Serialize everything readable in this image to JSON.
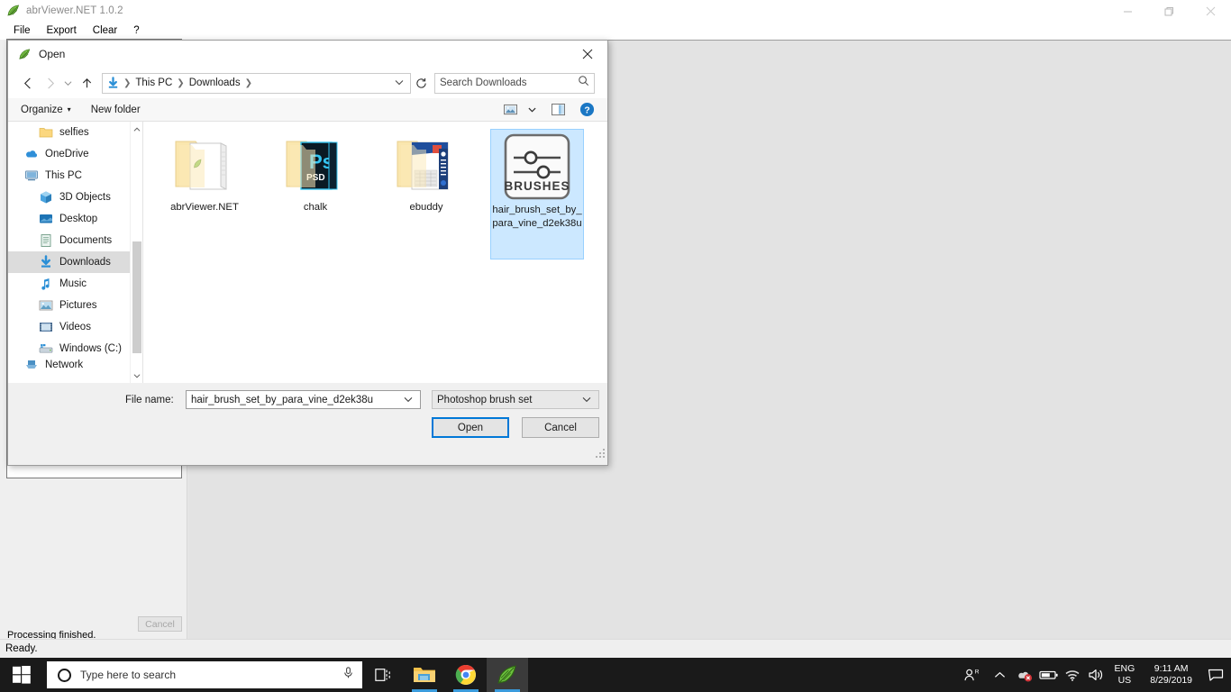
{
  "app": {
    "title": "abrViewer.NET 1.0.2",
    "icon": "leaf-brush-icon",
    "menu": [
      "File",
      "Export",
      "Clear",
      "?"
    ],
    "window_controls": {
      "minimize": "minimize-icon",
      "maximize": "restore-icon",
      "close": "close-icon"
    },
    "left_panel": {
      "cancel_label": "Cancel",
      "processing_label": "Processing finished."
    },
    "status_text": "Ready."
  },
  "dialog": {
    "title": "Open",
    "icon": "leaf-brush-icon",
    "close_label": "✕",
    "nav": {
      "back": "←",
      "forward": "→",
      "recent": "⌄",
      "up": "↑",
      "breadcrumbs": [
        "This PC",
        "Downloads"
      ],
      "address_icon": "downloads-arrow-icon",
      "dropdown_caret": "⌄",
      "refresh": "↻"
    },
    "search": {
      "placeholder": "Search Downloads",
      "icon": "search-icon"
    },
    "commandbar": {
      "organize": "Organize",
      "organize_caret": "▾",
      "new_folder": "New folder",
      "view_icon": "view-options-icon",
      "view_caret": "▾",
      "pane_icon": "preview-pane-icon",
      "help_icon": "help-icon",
      "help_glyph": "?"
    },
    "nav_pane": {
      "items": [
        {
          "label": "selfies",
          "icon": "folder-icon",
          "indent": 2,
          "selected": false
        },
        {
          "label": "OneDrive",
          "icon": "onedrive-cloud-icon",
          "indent": 1,
          "selected": false
        },
        {
          "label": "This PC",
          "icon": "this-pc-icon",
          "indent": 1,
          "selected": false
        },
        {
          "label": "3D Objects",
          "icon": "3d-objects-icon",
          "indent": 2,
          "selected": false
        },
        {
          "label": "Desktop",
          "icon": "desktop-icon",
          "indent": 2,
          "selected": false
        },
        {
          "label": "Documents",
          "icon": "documents-icon",
          "indent": 2,
          "selected": false
        },
        {
          "label": "Downloads",
          "icon": "downloads-arrow-icon",
          "indent": 2,
          "selected": true
        },
        {
          "label": "Music",
          "icon": "music-note-icon",
          "indent": 2,
          "selected": false
        },
        {
          "label": "Pictures",
          "icon": "pictures-icon",
          "indent": 2,
          "selected": false
        },
        {
          "label": "Videos",
          "icon": "videos-icon",
          "indent": 2,
          "selected": false
        },
        {
          "label": "Windows (C:)",
          "icon": "drive-icon",
          "indent": 2,
          "selected": false
        },
        {
          "label": "Network",
          "icon": "network-icon",
          "indent": 1,
          "selected": false
        }
      ],
      "scroll_up": "⌃",
      "scroll_down": "⌄"
    },
    "files": [
      {
        "name": "abrViewer.NET",
        "thumb": "folder-with-leaf-icon",
        "selected": false
      },
      {
        "name": "chalk",
        "thumb": "folder-with-psd-icon",
        "selected": false
      },
      {
        "name": "ebuddy",
        "thumb": "folder-with-document-icon",
        "selected": false
      },
      {
        "name": "hair_brush_set_by_para_vine_d2ek38u",
        "thumb": "brushes-slider-icon",
        "thumb_text": "BRUSHES",
        "selected": true
      }
    ],
    "footer": {
      "filename_label": "File name:",
      "filename_value": "hair_brush_set_by_para_vine_d2ek38u",
      "filetype_value": "Photoshop brush set",
      "combo_caret": "⌄",
      "open_label": "Open",
      "cancel_label": "Cancel"
    }
  },
  "taskbar": {
    "start_icon": "windows-logo-icon",
    "search_placeholder": "Type here to search",
    "search_icon": "search-circle-icon",
    "mic_icon": "microphone-icon",
    "buttons": [
      {
        "name": "task-view",
        "icon": "task-view-icon",
        "active": false,
        "underline": false
      },
      {
        "name": "file-explorer",
        "icon": "file-explorer-icon",
        "active": false,
        "underline": true
      },
      {
        "name": "google-chrome",
        "icon": "chrome-icon",
        "active": false,
        "underline": true
      },
      {
        "name": "abrviewer",
        "icon": "leaf-brush-icon",
        "active": true,
        "underline": true
      }
    ],
    "tray": {
      "people_icon": "people-icon",
      "chevron_icon": "chevron-up-icon",
      "onedrive_icon": "onedrive-error-icon",
      "battery_icon": "battery-icon",
      "wifi_icon": "wifi-icon",
      "volume_icon": "volume-icon",
      "lang_line1": "ENG",
      "lang_line2": "US",
      "time": "9:11 AM",
      "date": "8/29/2019",
      "notification_icon": "action-center-icon"
    }
  },
  "colors": {
    "accent": "#0078d7",
    "selection": "#cce8ff",
    "taskbar": "#1a1a1a",
    "dialog_bg": "#f0f0f0"
  }
}
